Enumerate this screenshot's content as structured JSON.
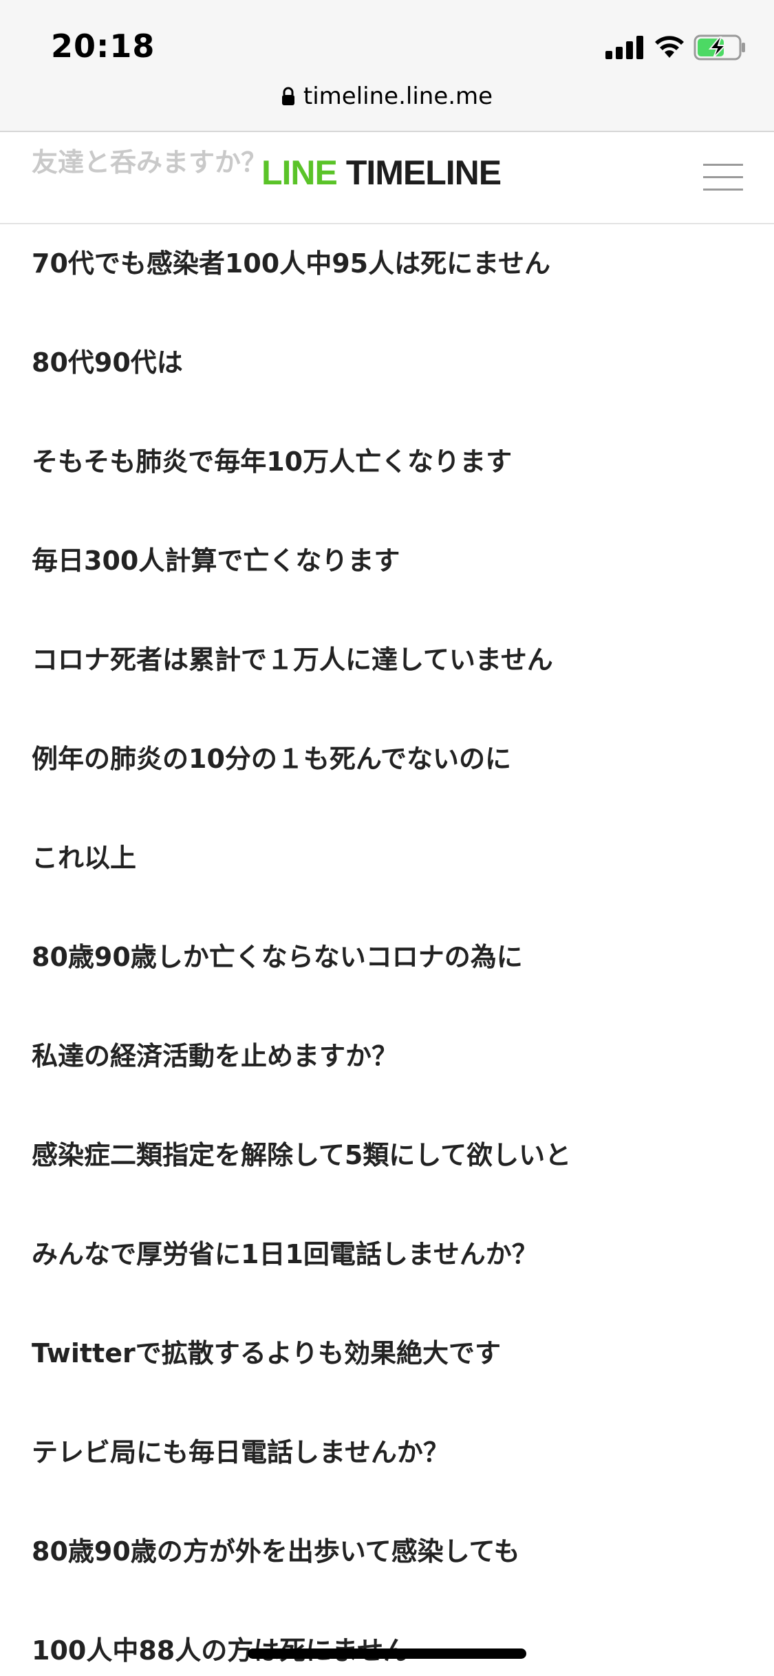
{
  "status_bar": {
    "time": "20:18"
  },
  "browser": {
    "url": "timeline.line.me"
  },
  "header": {
    "logo_line": "LINE",
    "logo_timeline": "TIMELINE",
    "scrolled_text": "友達と呑みますか？"
  },
  "post": {
    "lines": [
      "70代でも感染者100人中95人は死にません",
      "80代90代は",
      "そもそも肺炎で毎年10万人亡くなります",
      "毎日300人計算で亡くなります",
      "コロナ死者は累計で１万人に達していません",
      "例年の肺炎の10分の１も死んでないのに",
      "これ以上",
      "80歳90歳しか亡くならないコロナの為に",
      "私達の経済活動を止めますか？",
      "感染症二類指定を解除して5類にして欲しいと",
      "みんなで厚労省に1日1回電話しませんか？",
      "Twitterで拡散するよりも効果絶大です",
      "テレビ局にも毎日電話しませんか？",
      "80歳90歳の方が外を出歩いて感染しても",
      "100人中88人の方は死にません"
    ]
  },
  "colors": {
    "line_green": "#5ac328",
    "text": "#222222",
    "chrome_bg": "#f6f6f6"
  },
  "icons": [
    "signal-icon",
    "wifi-icon",
    "battery-charging-icon",
    "lock-icon",
    "hamburger-menu-icon"
  ]
}
